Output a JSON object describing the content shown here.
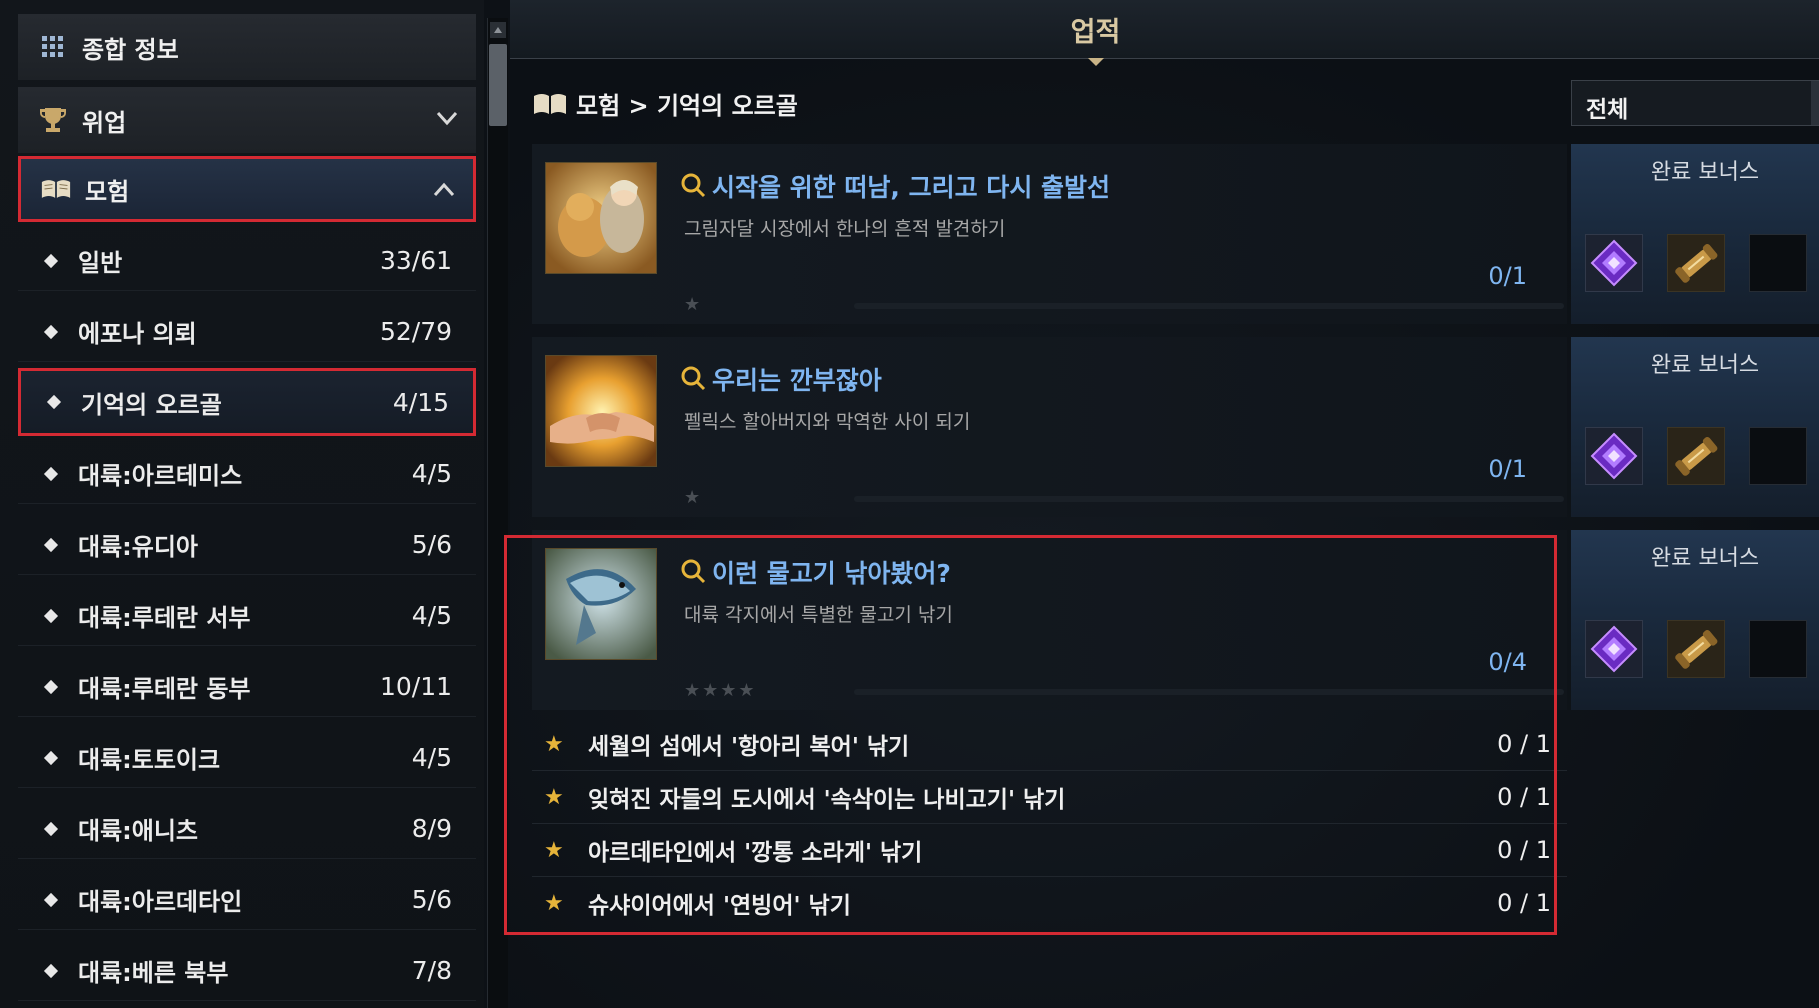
{
  "sidebar": {
    "categories": [
      {
        "label": "종합 정보",
        "icon": "grid-icon"
      },
      {
        "label": "위업",
        "icon": "trophy-icon"
      },
      {
        "label": "모험",
        "icon": "open-book-icon"
      }
    ],
    "subcategories": [
      {
        "label": "일반",
        "count": "33/61"
      },
      {
        "label": "에포나 의뢰",
        "count": "52/79"
      },
      {
        "label": "기억의 오르골",
        "count": "4/15"
      },
      {
        "label": "대륙:아르테미스",
        "count": "4/5"
      },
      {
        "label": "대륙:유디아",
        "count": "5/6"
      },
      {
        "label": "대륙:루테란 서부",
        "count": "4/5"
      },
      {
        "label": "대륙:루테란 동부",
        "count": "10/11"
      },
      {
        "label": "대륙:토토이크",
        "count": "4/5"
      },
      {
        "label": "대륙:애니츠",
        "count": "8/9"
      },
      {
        "label": "대륙:아르데타인",
        "count": "5/6"
      },
      {
        "label": "대륙:베른 북부",
        "count": "7/8"
      }
    ]
  },
  "header": {
    "title": "업적"
  },
  "breadcrumb": {
    "text": "모험 > 기억의 오르골"
  },
  "filter": {
    "selected": "전체"
  },
  "achievements": [
    {
      "title": "시작을 위한 떠남, 그리고 다시 출발선",
      "desc": "그림자달 시장에서 한나의 흔적 발견하기",
      "progress": "0/1",
      "stars": "★",
      "bonus_label": "완료 보너스"
    },
    {
      "title": "우리는 깐부잖아",
      "desc": "펠릭스 할아버지와 막역한 사이 되기",
      "progress": "0/1",
      "stars": "★",
      "bonus_label": "완료 보너스"
    },
    {
      "title": "이런 물고기 낚아봤어?",
      "desc": "대륙 각지에서 특별한 물고기 낚기",
      "progress": "0/4",
      "stars": "★★★★",
      "bonus_label": "완료 보너스"
    }
  ],
  "requirements": [
    {
      "text": "세월의 섬에서 '항아리 복어' 낚기",
      "count": "0 / 1"
    },
    {
      "text": "잊혀진 자들의 도시에서 '속삭이는 나비고기' 낚기",
      "count": "0 / 1"
    },
    {
      "text": "아르데타인에서 '깡통 소라게' 낚기",
      "count": "0 / 1"
    },
    {
      "text": "슈샤이어에서 '연빙어' 낚기",
      "count": "0 / 1"
    }
  ],
  "colors": {
    "accent_blue": "#7fb5f0",
    "highlight_red": "#d42a33",
    "star_gold": "#e6b43a",
    "title_gold": "#d9c9a3"
  }
}
